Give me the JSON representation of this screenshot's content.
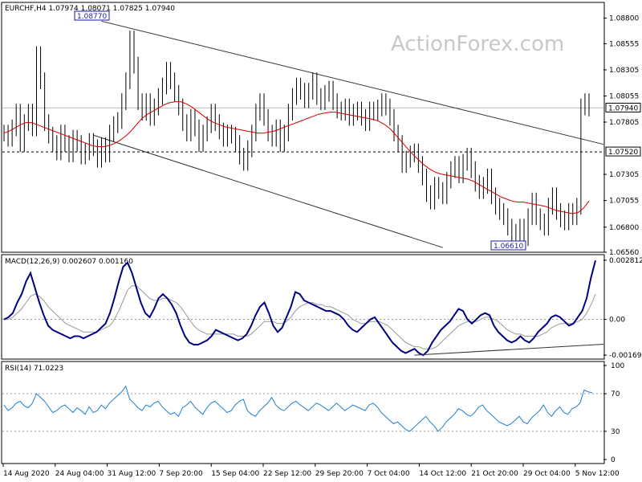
{
  "chart_data": [
    {
      "type": "line",
      "title": "EURCHF,H4  1.07974 1.08071 1.07825 1.07940",
      "watermark": "ActionForex.com",
      "ylim": [
        1.0656,
        1.0895
      ],
      "yticks": [
        "1.08800",
        "1.08555",
        "1.08305",
        "1.08055",
        "1.07805",
        "1.07305",
        "1.07055",
        "1.06800",
        "1.06560"
      ],
      "current_price_label": "1.07940",
      "current_price": 1.0794,
      "support_label": "1.07520",
      "support_level": 1.0752,
      "high_label": "1.08770",
      "high_value": 1.0877,
      "low_label": "1.06610",
      "low_value": 1.0661,
      "xticks": [
        "14 Aug 2020",
        "24 Aug 04:00",
        "31 Aug 12:00",
        "7 Sep 20:00",
        "15 Sep 04:00",
        "22 Sep 12:00",
        "29 Sep 20:00",
        "7 Oct 04:00",
        "14 Oct 12:00",
        "21 Oct 20:00",
        "29 Oct 04:00",
        "5 Nov 12:00"
      ],
      "price_series": [
        1.077,
        1.0765,
        1.0775,
        1.079,
        1.076,
        1.078,
        1.079,
        1.0775,
        1.0845,
        1.082,
        1.078,
        1.0768,
        1.076,
        1.0752,
        1.077,
        1.076,
        1.075,
        1.0765,
        1.076,
        1.0748,
        1.0752,
        1.0762,
        1.0756,
        1.0745,
        1.0758,
        1.075,
        1.077,
        1.0778,
        1.0782,
        1.08,
        1.082,
        1.086,
        1.0835,
        1.08,
        1.079,
        1.08,
        1.0785,
        1.0795,
        1.0805,
        1.0815,
        1.083,
        1.082,
        1.0808,
        1.0795,
        1.078,
        1.077,
        1.0785,
        1.0775,
        1.076,
        1.077,
        1.0778,
        1.079,
        1.078,
        1.0772,
        1.0765,
        1.077,
        1.0768,
        1.076,
        1.0748,
        1.0742,
        1.0755,
        1.077,
        1.079,
        1.08,
        1.0785,
        1.077,
        1.0765,
        1.0775,
        1.076,
        1.077,
        1.079,
        1.0805,
        1.0815,
        1.081,
        1.0802,
        1.081,
        1.082,
        1.0805,
        1.08,
        1.0808,
        1.0812,
        1.08,
        1.0792,
        1.079,
        1.0795,
        1.0785,
        1.079,
        1.0792,
        1.0785,
        1.078,
        1.0792,
        1.079,
        1.0794,
        1.08,
        1.0795,
        1.0785,
        1.077,
        1.076,
        1.074,
        1.0745,
        1.075,
        1.0752,
        1.074,
        1.0728,
        1.0712,
        1.0705,
        1.072,
        1.0715,
        1.071,
        1.0725,
        1.0735,
        1.074,
        1.073,
        1.0742,
        1.0748,
        1.0735,
        1.0722,
        1.0715,
        1.072,
        1.0728,
        1.071,
        1.07,
        1.0695,
        1.069,
        1.068,
        1.0672,
        1.0675,
        1.068,
        1.067,
        1.069,
        1.0705,
        1.069,
        1.0685,
        1.068,
        1.07,
        1.071,
        1.0695,
        1.0688,
        1.0685,
        1.0695,
        1.069,
        1.07,
        1.0795,
        1.08,
        1.0794
      ],
      "ma_series": [
        1.077,
        1.0772,
        1.0775,
        1.0778,
        1.078,
        1.078,
        1.0778,
        1.0776,
        1.0774,
        1.0772,
        1.077,
        1.0768,
        1.0766,
        1.0764,
        1.0762,
        1.076,
        1.0758,
        1.0757,
        1.0757,
        1.0758,
        1.076,
        1.0763,
        1.0767,
        1.0772,
        1.0778,
        1.0784,
        1.0788,
        1.0791,
        1.0794,
        1.0797,
        1.0799,
        1.08,
        1.08,
        1.0798,
        1.0795,
        1.0791,
        1.0787,
        1.0783,
        1.078,
        1.0778,
        1.0776,
        1.0775,
        1.0774,
        1.0773,
        1.0772,
        1.0771,
        1.077,
        1.077,
        1.0771,
        1.0772,
        1.0774,
        1.0776,
        1.0778,
        1.078,
        1.0782,
        1.0784,
        1.0786,
        1.0788,
        1.0789,
        1.079,
        1.079,
        1.0789,
        1.0788,
        1.0787,
        1.0786,
        1.0785,
        1.0784,
        1.0783,
        1.0781,
        1.0778,
        1.0774,
        1.0768,
        1.0762,
        1.0756,
        1.075,
        1.0745,
        1.074,
        1.0736,
        1.0733,
        1.0731,
        1.073,
        1.0729,
        1.0728,
        1.0727,
        1.0726,
        1.0724,
        1.0721,
        1.0718,
        1.0715,
        1.0712,
        1.0709,
        1.0707,
        1.0705,
        1.0704,
        1.0704,
        1.0703,
        1.0702,
        1.0701,
        1.07,
        1.0698,
        1.0696,
        1.0695,
        1.0694,
        1.0693,
        1.0694,
        1.0698,
        1.0705
      ],
      "resistance_line": [
        [
          1.0877,
          1.075
        ]
      ],
      "support_channel": [
        [
          1.0768,
          1.0662
        ]
      ]
    },
    {
      "type": "line",
      "title": "MACD(12,26,9) 0.002607 0.001160",
      "ylim": [
        -0.00185,
        0.003
      ],
      "yticks": [
        "0.002812",
        "0.00",
        "-0.001698"
      ],
      "macd_series": [
        0.0,
        0.0001,
        0.0003,
        0.0008,
        0.0012,
        0.0018,
        0.0022,
        0.0015,
        0.0008,
        0.0002,
        -0.0003,
        -0.0005,
        -0.0006,
        -0.0007,
        -0.0008,
        -0.0009,
        -0.0008,
        -0.0008,
        -0.0009,
        -0.0008,
        -0.0007,
        -0.0006,
        -0.0004,
        -0.0002,
        0.0003,
        0.001,
        0.0018,
        0.0025,
        0.0027,
        0.0022,
        0.0015,
        0.0008,
        0.0003,
        0.0001,
        0.0005,
        0.001,
        0.0012,
        0.001,
        0.0007,
        0.0003,
        -0.0003,
        -0.0008,
        -0.0011,
        -0.0012,
        -0.0012,
        -0.0011,
        -0.001,
        -0.0008,
        -0.0005,
        -0.0006,
        -0.0007,
        -0.0008,
        -0.0009,
        -0.001,
        -0.0009,
        -0.0007,
        -0.0003,
        0.0002,
        0.0006,
        0.0008,
        0.0003,
        -0.0003,
        -0.0006,
        -0.0004,
        0.0001,
        0.0006,
        0.0013,
        0.0012,
        0.0009,
        0.0008,
        0.0007,
        0.0006,
        0.0005,
        0.0004,
        0.0004,
        0.0003,
        0.0002,
        0.0,
        -0.0003,
        -0.0005,
        -0.0006,
        -0.0004,
        -0.0002,
        0.0,
        0.0001,
        -0.0002,
        -0.0005,
        -0.0008,
        -0.0011,
        -0.0013,
        -0.0015,
        -0.0016,
        -0.0015,
        -0.0014,
        -0.0016,
        -0.0017,
        -0.0015,
        -0.0011,
        -0.0008,
        -0.0005,
        -0.0003,
        -0.0001,
        0.0002,
        0.0005,
        0.0004,
        0.0,
        -0.0002,
        0.0,
        0.0002,
        0.0003,
        0.0002,
        -0.0003,
        -0.0006,
        -0.0008,
        -0.001,
        -0.0011,
        -0.001,
        -0.0008,
        -0.001,
        -0.0011,
        -0.0009,
        -0.0006,
        -0.0004,
        -0.0002,
        0.0001,
        0.0002,
        0.0001,
        -0.0001,
        -0.0003,
        -0.0002,
        0.0001,
        0.0004,
        0.001,
        0.002,
        0.0028
      ],
      "signal_series": [
        0.0,
        0.0,
        0.0001,
        0.0003,
        0.0005,
        0.0008,
        0.0011,
        0.0012,
        0.0011,
        0.0009,
        0.0006,
        0.0004,
        0.0002,
        0.0,
        -0.0002,
        -0.0003,
        -0.0004,
        -0.0005,
        -0.0006,
        -0.0006,
        -0.0006,
        -0.0006,
        -0.0005,
        -0.0004,
        -0.0003,
        0.0,
        0.0004,
        0.0009,
        0.0014,
        0.0016,
        0.0016,
        0.0014,
        0.0012,
        0.001,
        0.0009,
        0.0009,
        0.001,
        0.001,
        0.0009,
        0.0008,
        0.0006,
        0.0003,
        0.0,
        -0.0003,
        -0.0005,
        -0.0006,
        -0.0007,
        -0.0007,
        -0.0007,
        -0.0007,
        -0.0007,
        -0.0007,
        -0.0007,
        -0.0008,
        -0.0008,
        -0.0008,
        -0.0007,
        -0.0005,
        -0.0003,
        -0.0001,
        -0.0001,
        -0.0001,
        -0.0002,
        -0.0002,
        -0.0001,
        0.0001,
        0.0004,
        0.0006,
        0.0007,
        0.0008,
        0.0008,
        0.0007,
        0.0007,
        0.0006,
        0.0006,
        0.0005,
        0.0004,
        0.0003,
        0.0002,
        0.0,
        -0.0001,
        -0.0002,
        -0.0002,
        -0.0001,
        -0.0001,
        -0.0001,
        -0.0002,
        -0.0003,
        -0.0005,
        -0.0007,
        -0.0009,
        -0.0011,
        -0.0012,
        -0.0013,
        -0.0013,
        -0.0014,
        -0.0014,
        -0.0014,
        -0.0013,
        -0.0011,
        -0.0009,
        -0.0007,
        -0.0005,
        -0.0003,
        -0.0002,
        -0.0001,
        -0.0001,
        -0.0001,
        0.0,
        0.0001,
        0.0001,
        0.0,
        -0.0001,
        -0.0003,
        -0.0005,
        -0.0006,
        -0.0007,
        -0.0007,
        -0.0008,
        -0.0008,
        -0.0008,
        -0.0008,
        -0.0007,
        -0.0006,
        -0.0004,
        -0.0003,
        -0.0002,
        -0.0002,
        -0.0002,
        -0.0002,
        -0.0001,
        0.0,
        0.0003,
        0.0007,
        0.0012
      ],
      "trendline": [
        [
          -0.0017,
          -0.0008
        ]
      ]
    },
    {
      "type": "line",
      "title": "RSI(14) 71.0223",
      "ylim": [
        0,
        100
      ],
      "yticks": [
        "100",
        "70",
        "30",
        "0"
      ],
      "levels": [
        70,
        30
      ],
      "rsi_series": [
        58,
        52,
        55,
        60,
        62,
        57,
        55,
        60,
        70,
        66,
        62,
        56,
        50,
        52,
        56,
        58,
        54,
        50,
        55,
        52,
        48,
        56,
        50,
        52,
        58,
        54,
        60,
        64,
        68,
        72,
        78,
        64,
        60,
        55,
        52,
        58,
        56,
        60,
        62,
        56,
        52,
        48,
        50,
        46,
        55,
        58,
        62,
        56,
        52,
        48,
        55,
        60,
        62,
        58,
        54,
        50,
        52,
        58,
        62,
        64,
        52,
        48,
        46,
        52,
        56,
        60,
        66,
        58,
        54,
        52,
        56,
        60,
        62,
        58,
        55,
        52,
        56,
        60,
        58,
        55,
        52,
        56,
        60,
        56,
        52,
        55,
        58,
        56,
        54,
        52,
        58,
        60,
        56,
        50,
        46,
        42,
        38,
        40,
        36,
        32,
        30,
        34,
        38,
        42,
        46,
        40,
        36,
        30,
        34,
        40,
        44,
        48,
        54,
        52,
        48,
        46,
        50,
        56,
        58,
        52,
        48,
        44,
        40,
        38,
        36,
        38,
        42,
        46,
        40,
        38,
        44,
        48,
        52,
        58,
        50,
        46,
        52,
        56,
        50,
        48,
        54,
        56,
        60,
        74,
        72,
        71
      ]
    }
  ]
}
